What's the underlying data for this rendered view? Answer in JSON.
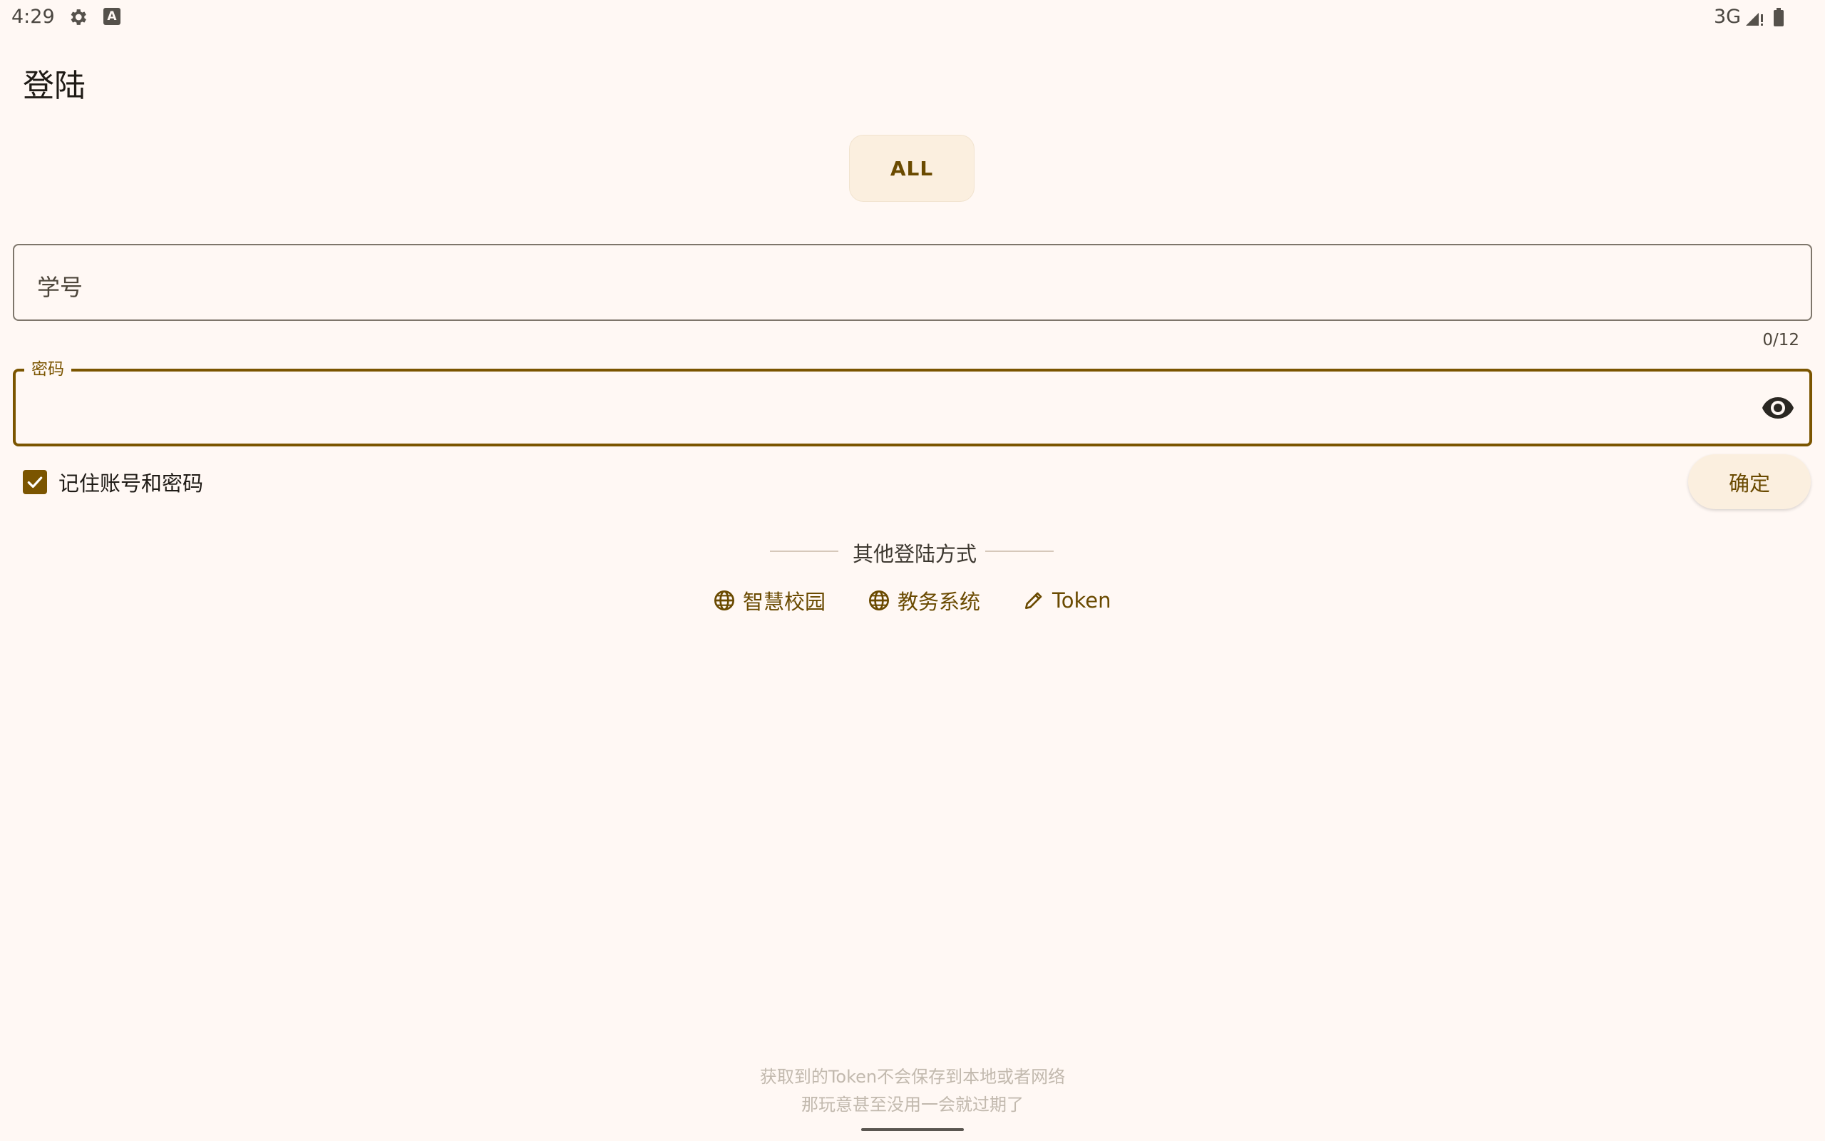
{
  "status_bar": {
    "time": "4:29",
    "network": "3G",
    "icons": [
      "gear-icon",
      "a-notification-icon",
      "signal-icon",
      "battery-icon"
    ]
  },
  "page": {
    "title": "登陆"
  },
  "school_chip": {
    "label": "ALL"
  },
  "student_id_field": {
    "label": "学号",
    "value": "",
    "counter": "0/12"
  },
  "password_field": {
    "label": "密码",
    "value": "",
    "toggle_icon": "eye-icon"
  },
  "remember": {
    "label": "记住账号和密码",
    "checked": true
  },
  "confirm_button": {
    "label": "确定"
  },
  "other_login": {
    "title": "其他登陆方式",
    "options": [
      {
        "label": "智慧校园",
        "icon": "globe-icon"
      },
      {
        "label": "教务系统",
        "icon": "globe-icon"
      },
      {
        "label": "Token",
        "icon": "pencil-icon"
      }
    ]
  },
  "footer": {
    "line1": "获取到的Token不会保存到本地或者网络",
    "line2": "那玩意甚至没用一会就过期了"
  },
  "colors": {
    "background": "#FFF8F4",
    "primary": "#7B5500",
    "chip_bg": "#FBEFDF",
    "outline": "#7E766B"
  }
}
